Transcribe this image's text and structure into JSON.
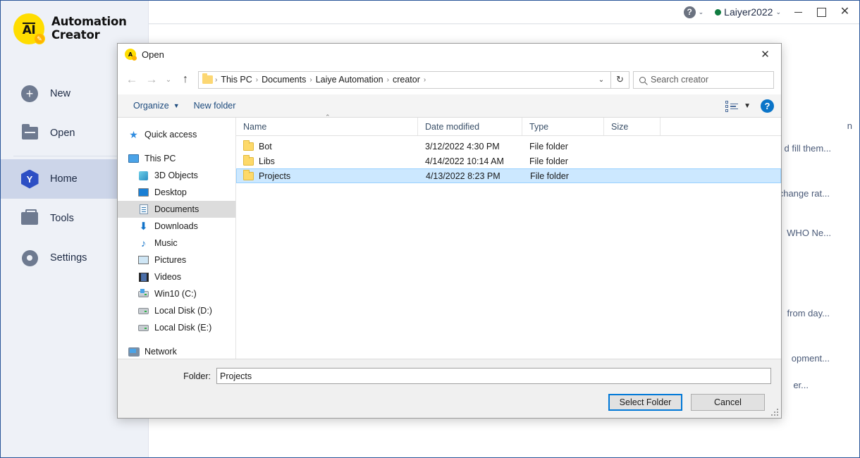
{
  "app": {
    "brand_line1": "Automation",
    "brand_line2": "Creator",
    "logo_text": "AI",
    "titlebar": {
      "help_icon": "help-circle-icon",
      "help_caret": "⌄",
      "user_name": "Laiyer2022",
      "user_caret": "⌄",
      "minimize": "minimize-icon",
      "maximize": "maximize-icon",
      "close": "✕"
    },
    "sidebar": {
      "items": [
        {
          "label": "New",
          "icon": "plus-circle-icon",
          "active": false
        },
        {
          "label": "Open",
          "icon": "folder-icon",
          "active": false
        },
        {
          "label": "Home",
          "icon": "home-hex-icon",
          "active": true
        },
        {
          "label": "Tools",
          "icon": "toolbox-icon",
          "active": false
        },
        {
          "label": "Settings",
          "icon": "gear-icon",
          "active": false
        }
      ]
    },
    "background_fragments": [
      "n",
      "d fill them...",
      "change rat...",
      " WHO Ne...",
      "from day...",
      "opment...",
      "er..."
    ]
  },
  "dialog": {
    "title": "Open",
    "close_label": "✕",
    "nav": {
      "back": "←",
      "forward": "→",
      "history_caret": "⌄",
      "up": "↑",
      "breadcrumbs": [
        "This PC",
        "Documents",
        "Laiye Automation",
        "creator"
      ],
      "breadcrumb_sep": "›",
      "breadcrumb_dropdown": "⌄",
      "refresh": "↻"
    },
    "search": {
      "placeholder": "Search creator",
      "icon": "search-icon"
    },
    "toolbar": {
      "organize": "Organize",
      "organize_caret": "▼",
      "new_folder": "New folder",
      "view_icon": "view-layout-icon",
      "view_caret": "▼",
      "help_icon": "help-icon"
    },
    "tree": [
      {
        "label": "Quick access",
        "icon": "star-icon",
        "indent": false,
        "selected": false
      },
      {
        "label": "This PC",
        "icon": "this-pc-icon",
        "indent": false,
        "selected": false,
        "gap_before": true
      },
      {
        "label": "3D Objects",
        "icon": "3d-objects-icon",
        "indent": true,
        "selected": false
      },
      {
        "label": "Desktop",
        "icon": "desktop-icon",
        "indent": true,
        "selected": false
      },
      {
        "label": "Documents",
        "icon": "documents-icon",
        "indent": true,
        "selected": true
      },
      {
        "label": "Downloads",
        "icon": "downloads-icon",
        "indent": true,
        "selected": false
      },
      {
        "label": "Music",
        "icon": "music-icon",
        "indent": true,
        "selected": false
      },
      {
        "label": "Pictures",
        "icon": "pictures-icon",
        "indent": true,
        "selected": false
      },
      {
        "label": "Videos",
        "icon": "videos-icon",
        "indent": true,
        "selected": false
      },
      {
        "label": "Win10 (C:)",
        "icon": "drive-icon",
        "indent": true,
        "selected": false
      },
      {
        "label": "Local Disk (D:)",
        "icon": "drive-icon",
        "indent": true,
        "selected": false
      },
      {
        "label": "Local Disk (E:)",
        "icon": "drive-icon",
        "indent": true,
        "selected": false
      },
      {
        "label": "Network",
        "icon": "network-icon",
        "indent": false,
        "selected": false,
        "gap_before": true
      }
    ],
    "columns": [
      "Name",
      "Date modified",
      "Type",
      "Size"
    ],
    "sort_indicator": "⌃",
    "rows": [
      {
        "name": "Bot",
        "date": "3/12/2022 4:30 PM",
        "type": "File folder",
        "size": "",
        "selected": false
      },
      {
        "name": "Libs",
        "date": "4/14/2022 10:14 AM",
        "type": "File folder",
        "size": "",
        "selected": false
      },
      {
        "name": "Projects",
        "date": "4/13/2022 8:23 PM",
        "type": "File folder",
        "size": "",
        "selected": true
      }
    ],
    "footer": {
      "folder_label": "Folder:",
      "folder_value": "Projects",
      "select_button": "Select Folder",
      "cancel_button": "Cancel"
    }
  },
  "colors": {
    "brand_yellow": "#ffdd00",
    "accent_blue": "#0078d7",
    "selection_blue": "#cce8ff",
    "sidebar_bg": "#eef1f7",
    "sidebar_active": "#ccd5e9",
    "status_green": "#107c41"
  }
}
